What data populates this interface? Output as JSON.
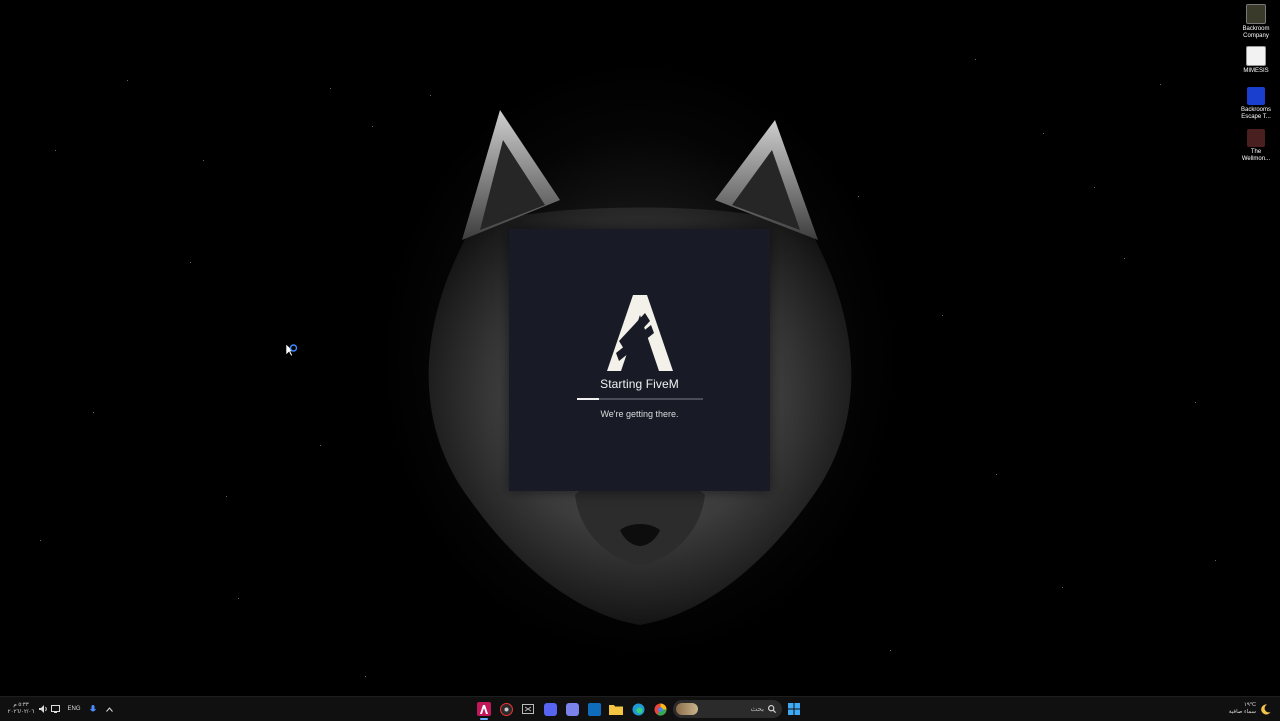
{
  "desktop": {
    "icons": [
      {
        "label_line1": "Backroom",
        "label_line2": "Company",
        "icon": "backroom-company-icon"
      },
      {
        "label_line1": "MIMESIS",
        "label_line2": "",
        "icon": "mimesis-icon"
      },
      {
        "label_line1": "Backrooms",
        "label_line2": "Escape T...",
        "icon": "backrooms-escape-icon"
      },
      {
        "label_line1": "The",
        "label_line2": "Wellmon...",
        "icon": "the-wellmon-icon"
      }
    ]
  },
  "splash": {
    "title": "Starting FiveM",
    "subtitle": "We're getting there.",
    "progress": 0.18,
    "logo": "fivem-logo"
  },
  "taskbar": {
    "clock_time": "٥:٣٣ م",
    "clock_date": "٢٠٢٦/٠٢/٠٦",
    "language": "ENG",
    "search_placeholder": "بحث",
    "weather_temp": "١٩°C",
    "weather_desc": "سماء صافية",
    "apps": [
      "fivem-icon",
      "steam-icon",
      "task-view-icon",
      "discord-icon",
      "teams-icon",
      "outlook-icon",
      "file-explorer-icon",
      "edge-icon",
      "browser-icon"
    ],
    "colors": {
      "accent": "#6aa9ff",
      "taskbar": "#101010",
      "splash": "#181b26"
    }
  }
}
